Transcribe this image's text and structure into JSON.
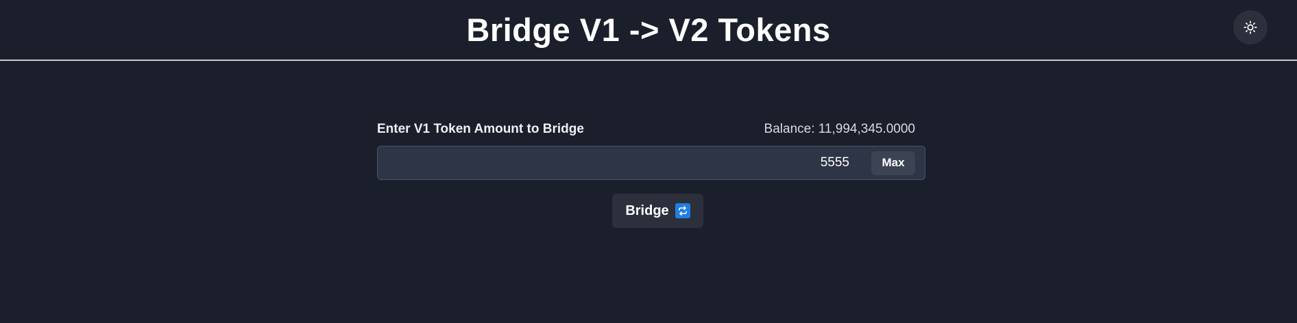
{
  "header": {
    "title": "Bridge V1 -> V2 Tokens",
    "theme_toggle_icon": "sun-icon"
  },
  "form": {
    "label": "Enter V1 Token Amount to Bridge",
    "balance_text": "Balance: 11,994,345.0000",
    "amount_value": "5555",
    "max_label": "Max"
  },
  "bridge_button": {
    "label": "Bridge",
    "icon": "repeat-icon"
  },
  "colors": {
    "background": "#1b1f2b",
    "input_background": "#2d3546",
    "button_background": "#2b303c",
    "accent_icon": "#1f7fe0"
  }
}
